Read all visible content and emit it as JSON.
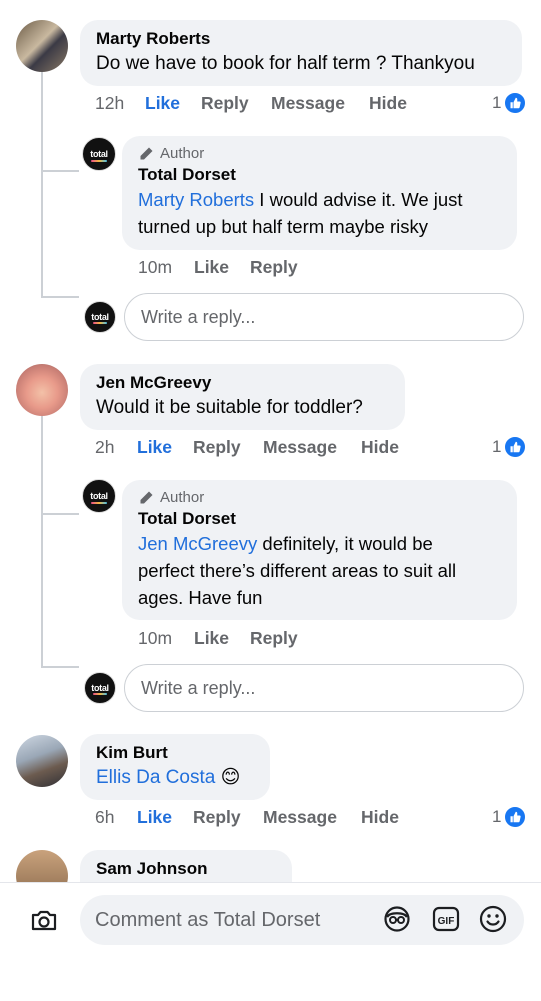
{
  "comments": [
    {
      "name": "Marty Roberts",
      "text": "Do we have to book for half term ? Thankyou",
      "time": "12h",
      "like": "Like",
      "reply": "Reply",
      "message": "Message",
      "hide": "Hide",
      "reaction_count": "1",
      "author_reply": {
        "badge": "Author",
        "name": "Total Dorset",
        "mention": "Marty Roberts",
        "line1": " I would advise it. We just",
        "line2": "turned up but half term maybe risky",
        "time": "10m",
        "like": "Like",
        "reply": "Reply"
      },
      "reply_placeholder": "Write a reply..."
    },
    {
      "name": "Jen McGreevy",
      "text": "Would it be suitable for toddler?",
      "time": "2h",
      "like": "Like",
      "reply": "Reply",
      "message": "Message",
      "hide": "Hide",
      "reaction_count": "1",
      "author_reply": {
        "badge": "Author",
        "name": "Total Dorset",
        "mention": "Jen McGreevy",
        "line1": " definitely, it would be",
        "line2": "perfect there’s different areas to suit all",
        "line3": "ages. Have fun",
        "time": "10m",
        "like": "Like",
        "reply": "Reply"
      },
      "reply_placeholder": "Write a reply..."
    },
    {
      "name": "Kim Burt",
      "mention": "Ellis Da Costa",
      "emoji": "😊",
      "time": "6h",
      "like": "Like",
      "reply": "Reply",
      "message": "Message",
      "hide": "Hide",
      "reaction_count": "1"
    },
    {
      "name": "Sam Johnson"
    }
  ],
  "brand_logo_text": "total",
  "composer": {
    "placeholder": "Comment as Total Dorset"
  },
  "colors": {
    "accent": "#216fdb",
    "bubble": "#f0f2f5",
    "secondary_text": "#65676b",
    "like_badge": "#1877f2"
  },
  "icons": [
    "camera-icon",
    "avatar-sticker-icon",
    "gif-icon",
    "emoji-icon",
    "pen-icon",
    "like-icon"
  ]
}
